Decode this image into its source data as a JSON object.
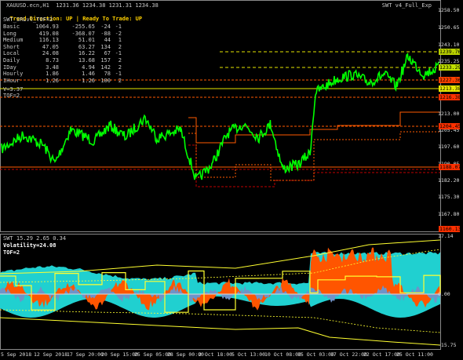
{
  "header": {
    "symbol_line": "XAUUSD.ecn,H1  1231.36 1234.38 1231.31 1234.38",
    "trend_direction_label": "Trend Direction:",
    "trend_direction_value": "UP",
    "ready_label": "Ready To Trade:",
    "ready_value": "UP",
    "indicator_name": "SWT_SRLvl_TOF=2",
    "expert_label": "SWT v4_Full_Exp"
  },
  "stats": [
    {
      "name": "Basic",
      "a": "1064.93",
      "b": "-255.65",
      "c": "-24",
      "d": "-1"
    },
    {
      "name": "Long",
      "a": "419.08",
      "b": "-368.07",
      "c": "-88",
      "d": "-2"
    },
    {
      "name": "Medium",
      "a": "116.13",
      "b": "51.01",
      "c": "44",
      "d": "1"
    },
    {
      "name": "Short",
      "a": "47.05",
      "b": "63.27",
      "c": "134",
      "d": "2"
    },
    {
      "name": "Local",
      "a": "24.08",
      "b": "16.22",
      "c": "67",
      "d": "-1"
    },
    {
      "name": "Daily",
      "a": "8.73",
      "b": "13.68",
      "c": "157",
      "d": "2"
    },
    {
      "name": "IDay",
      "a": "3.48",
      "b": "4.94",
      "c": "142",
      "d": "2"
    },
    {
      "name": "Hourly",
      "a": "1.86",
      "b": "1.46",
      "c": "78",
      "d": "-1"
    },
    {
      "name": "IHour",
      "a": "1.26",
      "b": "1.26",
      "c": "100",
      "d": "2"
    }
  ],
  "stats_v": "V=3.37",
  "stats_tof": "TOF=2",
  "sub": {
    "title": "SWT 15.29 2.65 0.34",
    "volatility": "Volatility=24.08",
    "tof": "TOF=2"
  },
  "colors": {
    "price": "#00ff00",
    "resistance": "#ff5a00",
    "resistance_dark": "#c00000",
    "level_yellow": "#e6e600",
    "fill_cyan": "#20d0d0",
    "fill_orange": "#ff5500",
    "fill_blue": "#6f93c8",
    "band_yellow": "#ffff30"
  },
  "y_axis_main": {
    "ticks": [
      "1258.50",
      "1250.65",
      "1243.10",
      "1235.25",
      "1220.85",
      "1213.00",
      "1205.45",
      "1197.60",
      "1190.05",
      "1182.20",
      "1175.30",
      "1167.80"
    ],
    "badges": [
      {
        "label": "1239.76",
        "bg": "#b8d000"
      },
      {
        "label": "1233.29",
        "bg": "#c0e000"
      },
      {
        "label": "1227.36",
        "bg": "#ff4000"
      },
      {
        "label": "1213.38",
        "bg": "#e8e800"
      },
      {
        "label": "1216.38",
        "bg": "#ff3000"
      },
      {
        "label": "1204.45",
        "bg": "#ff3000"
      },
      {
        "label": "1188.07",
        "bg": "#ff3000"
      },
      {
        "label": "1160.13",
        "bg": "#ff3000"
      }
    ]
  },
  "y_axis_sub": {
    "ticks": [
      "17.14",
      "0.00",
      "-15.75"
    ]
  },
  "x_axis": {
    "ticks": [
      "5 Sep 2018",
      "12 Sep 2018",
      "17 Sep 20:00",
      "20 Sep 15:00",
      "25 Sep 05:00",
      "28 Sep 00:00",
      "2 Oct 18:00",
      "5 Oct 13:00",
      "10 Oct 08:00",
      "15 Oct 03:00",
      "17 Oct 22:00",
      "22 Oct 17:00",
      "25 Oct 11:00"
    ]
  }
}
